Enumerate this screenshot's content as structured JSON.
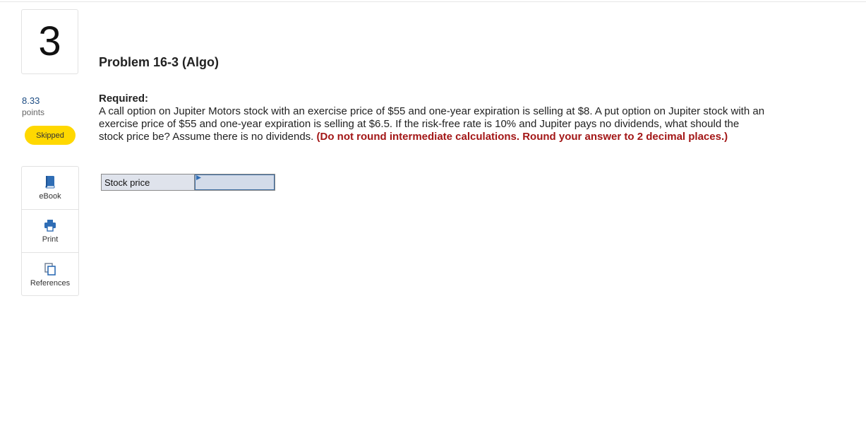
{
  "question": {
    "number": "3",
    "points_value": "8.33",
    "points_label": "points",
    "status": "Skipped"
  },
  "tools": [
    {
      "label": "eBook",
      "icon": "book-icon"
    },
    {
      "label": "Print",
      "icon": "printer-icon"
    },
    {
      "label": "References",
      "icon": "references-icon"
    }
  ],
  "problem": {
    "title": "Problem 16-3 (Algo)",
    "required_label": "Required:",
    "text": "A call option on Jupiter Motors stock with an exercise price of $55 and one-year expiration is selling at $8. A put option on Jupiter stock with an exercise price of $55 and one-year expiration is selling at $6.5. If the risk-free rate is 10% and Jupiter pays no dividends, what should the stock price be? Assume there is no dividends.",
    "instruction": "(Do not round intermediate calculations. Round your answer to 2 decimal places.)"
  },
  "answer": {
    "label": "Stock price",
    "value": ""
  },
  "colors": {
    "accent_blue": "#1c4c83",
    "badge_yellow": "#ffd800",
    "instruction_red": "#a31717",
    "icon_blue": "#2f6db5"
  }
}
